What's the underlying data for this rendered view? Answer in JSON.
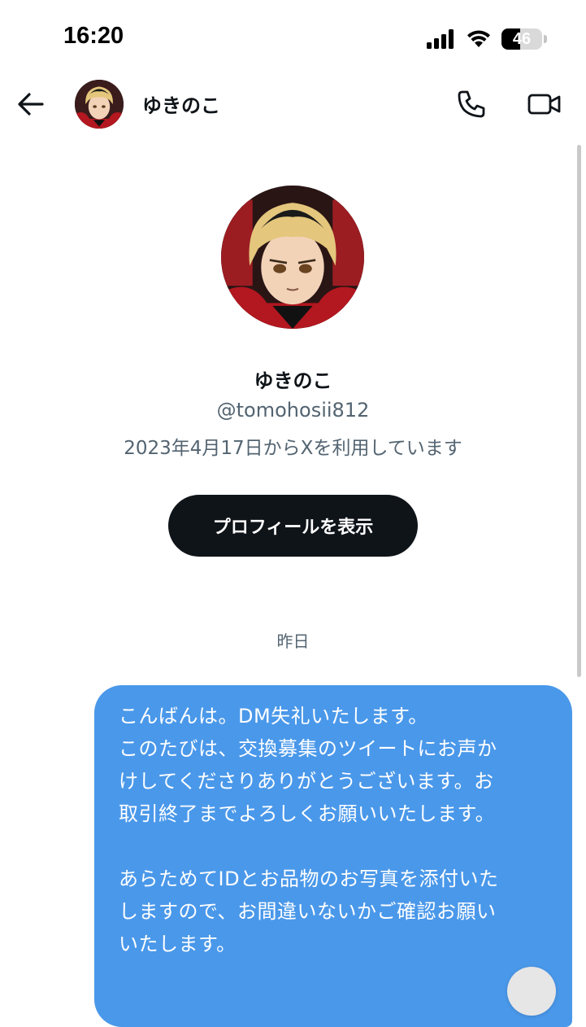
{
  "status_bar": {
    "time": "16:20",
    "battery_percent": 46,
    "battery_label": "46"
  },
  "header": {
    "contact_name": "ゆきのこ"
  },
  "profile": {
    "name": "ゆきのこ",
    "handle": "@tomohosii812",
    "joined": "2023年4月17日からXを利用しています",
    "view_profile_label": "プロフィールを表示"
  },
  "conversation": {
    "date_divider": "昨日",
    "messages": [
      {
        "lines": [
          "こんばんは。DM失礼いたします。",
          "このたびは、交換募集のツイートにお声か",
          "けしてくださりありがとうございます。お",
          "取引終了までよろしくお願いいたします。",
          "",
          "あらためてIDとお品物のお写真を添付いた",
          "しますので、お間違いないかご確認お願い",
          "いたします。"
        ]
      }
    ]
  },
  "colors": {
    "bubble": "#4a98ea",
    "button": "#0f1419",
    "muted_text": "#536471"
  }
}
